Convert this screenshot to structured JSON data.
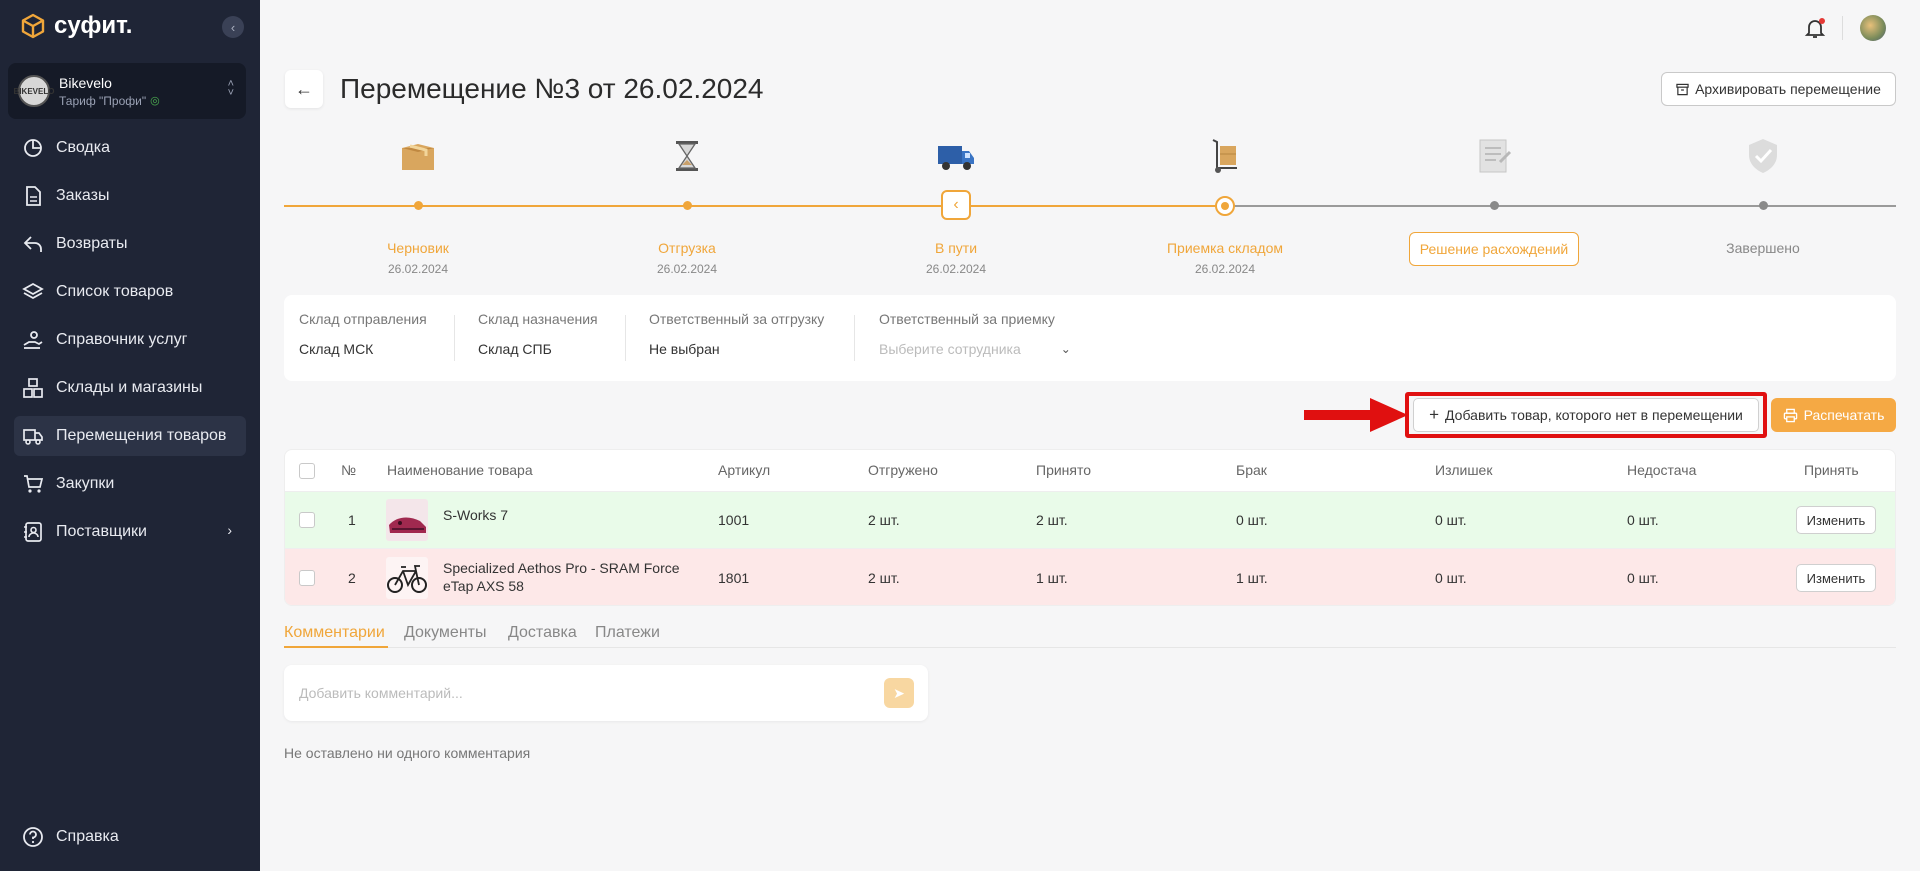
{
  "brand": {
    "name": "суфит."
  },
  "account": {
    "name": "Bikevelo",
    "plan": "Тариф \"Профи\"",
    "avatar_text": "BIKEVELO"
  },
  "nav": [
    {
      "label": "Сводка",
      "icon": "pie-chart-icon"
    },
    {
      "label": "Заказы",
      "icon": "document-icon"
    },
    {
      "label": "Возвраты",
      "icon": "return-arrow-icon"
    },
    {
      "label": "Список товаров",
      "icon": "layers-icon"
    },
    {
      "label": "Справочник услуг",
      "icon": "hand-service-icon"
    },
    {
      "label": "Склады и магазины",
      "icon": "boxes-icon"
    },
    {
      "label": "Перемещения товаров",
      "icon": "truck-icon",
      "active": true
    },
    {
      "label": "Закупки",
      "icon": "cart-icon"
    },
    {
      "label": "Поставщики",
      "icon": "contact-book-icon",
      "has_submenu": true
    }
  ],
  "help": {
    "label": "Справка"
  },
  "header": {
    "title": "Перемещение №3 от 26.02.2024",
    "archive_label": "Архивировать перемещение"
  },
  "stepper": [
    {
      "label": "Черновик",
      "date": "26.02.2024",
      "state": "done",
      "icon": "box-icon"
    },
    {
      "label": "Отгрузка",
      "date": "26.02.2024",
      "state": "done",
      "icon": "hourglass-icon"
    },
    {
      "label": "В пути",
      "date": "26.02.2024",
      "state": "current",
      "icon": "delivery-truck-icon"
    },
    {
      "label": "Приемка складом",
      "date": "26.02.2024",
      "state": "done",
      "icon": "hand-truck-icon"
    },
    {
      "label": "Решение расхождений",
      "date": "",
      "state": "active",
      "icon": "checklist-icon"
    },
    {
      "label": "Завершено",
      "date": "",
      "state": "pending",
      "icon": "shield-check-icon"
    }
  ],
  "info": {
    "from_label": "Склад отправления",
    "from_value": "Склад МСК",
    "to_label": "Склад назначения",
    "to_value": "Склад СПБ",
    "shipper_label": "Ответственный за отгрузку",
    "shipper_value": "Не выбран",
    "receiver_label": "Ответственный за приемку",
    "receiver_placeholder": "Выберите сотрудника"
  },
  "actions": {
    "add_label": "Добавить товар, которого нет в перемещении",
    "print_label": "Распечатать"
  },
  "table": {
    "headers": [
      "№",
      "Наименование товара",
      "Артикул",
      "Отгружено",
      "Принято",
      "Брак",
      "Излишек",
      "Недостача",
      "Принять"
    ],
    "rows": [
      {
        "num": "1",
        "name": "S-Works 7",
        "name2": "",
        "sku": "1001",
        "shipped": "2 шт.",
        "accepted": "2 шт.",
        "defect": "0 шт.",
        "surplus": "0 шт.",
        "shortage": "0 шт.",
        "action": "Изменить"
      },
      {
        "num": "2",
        "name": "Specialized Aethos Pro - SRAM Force",
        "name2": "eTap AXS 58",
        "sku": "1801",
        "shipped": "2 шт.",
        "accepted": "1 шт.",
        "defect": "1 шт.",
        "surplus": "0 шт.",
        "shortage": "0 шт.",
        "action": "Изменить"
      }
    ]
  },
  "tabs": [
    "Комментарии",
    "Документы",
    "Доставка",
    "Платежи"
  ],
  "comments": {
    "placeholder": "Добавить комментарий...",
    "empty": "Не оставлено ни одного комментария"
  },
  "colors": {
    "accent": "#f0a63a",
    "sidebar": "#1f2536",
    "highlight": "#e01010"
  }
}
